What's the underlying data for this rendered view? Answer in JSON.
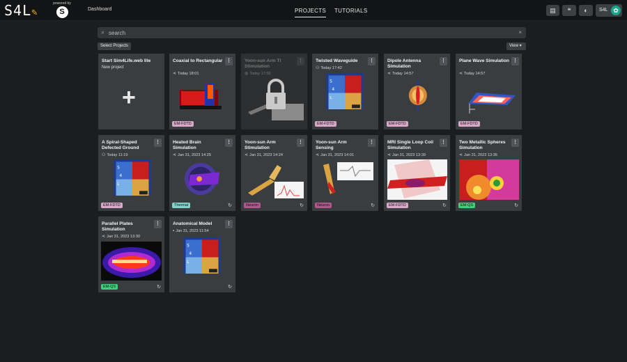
{
  "header": {
    "logo_text": "S4L",
    "powered_by": "powered by",
    "powered_badge": "S",
    "dashboard": "Dashboard",
    "tabs": [
      {
        "label": "PROJECTS",
        "active": true
      },
      {
        "label": "TUTORIALS",
        "active": false
      }
    ],
    "user_label": "S4L",
    "icons": [
      "book-icon",
      "chat-icon",
      "toggle-icon"
    ]
  },
  "search": {
    "placeholder": "search"
  },
  "toolbar": {
    "select_projects": "Select Projects",
    "view": "View"
  },
  "colors": {
    "em_fdtd": "#d8a8c8",
    "thermal": "#7fd6c8",
    "neuron": "#b0588c",
    "em_qs": "#3fcf7a"
  },
  "cards": [
    {
      "title": "Start Sim4Life.web lite",
      "subtitle": "New project"
    },
    {
      "title": "Coaxial to Rectangular",
      "meta": "Today 18:01",
      "tag": "EM-FDTD",
      "meta_icon": "share-icon"
    },
    {
      "title": "Yoon-sun Arm TI Stimulation",
      "meta": "Today 17:55",
      "meta_icon": "globe-icon",
      "locked": true
    },
    {
      "title": "Twisted Waveguide",
      "meta": "Today 17:42",
      "tag": "EM-FDTD",
      "meta_icon": "group-icon"
    },
    {
      "title": "Dipole Antenna Simulation",
      "meta": "Today 14:57",
      "tag": "EM-FDTD",
      "meta_icon": "share-icon"
    },
    {
      "title": "Plane Wave Simulation",
      "meta": "Today 14:57",
      "tag": "EM-FDTD",
      "meta_icon": "share-icon"
    },
    {
      "title": "A Spiral-Shaped Defected Ground",
      "meta": "Today 11:19",
      "tag": "EM-FDTD",
      "meta_icon": "group-icon"
    },
    {
      "title": "Heated Brain Simulation",
      "meta": "Jan 31, 2023 14:25",
      "tag": "Thermal",
      "meta_icon": "share-icon"
    },
    {
      "title": "Yoon-sun Arm Stimulation",
      "meta": "Jan 31, 2023 14:24",
      "tag": "Neuron",
      "meta_icon": "share-icon"
    },
    {
      "title": "Yoon-sun Arm Sensing",
      "meta": "Jan 31, 2023 14:01",
      "tag": "Neuron",
      "meta_icon": "share-icon"
    },
    {
      "title": "MRI Single Loop Coil Simulation",
      "meta": "Jan 31, 2023 13:39",
      "tag": "EM-FDTD",
      "meta_icon": "share-icon"
    },
    {
      "title": "Two Metallic Spheres Simulation",
      "meta": "Jan 31, 2023 13:35",
      "tag": "EM-QS",
      "meta_icon": "share-icon"
    },
    {
      "title": "Parallel Plates Simulation",
      "meta": "Jan 31, 2023 13:30",
      "tag": "EM-QS",
      "meta_icon": "share-icon"
    },
    {
      "title": "Anatomical Model",
      "meta": "Jan 31, 2023 11:54",
      "meta_icon": "user-icon"
    }
  ]
}
